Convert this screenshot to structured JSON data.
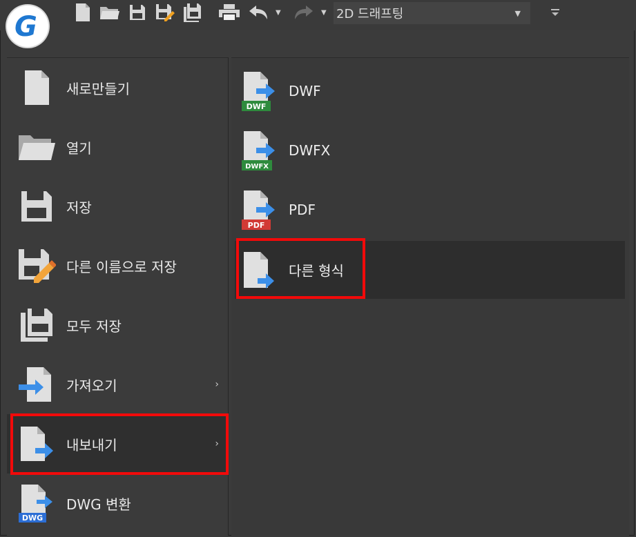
{
  "app": {
    "logo_letter": "G",
    "accent_color": "#1f78d1"
  },
  "quick_access": {
    "icons": [
      "new-file-icon",
      "open-folder-icon",
      "save-icon",
      "save-as-icon",
      "save-all-icon",
      "print-icon",
      "undo-icon",
      "redo-icon"
    ],
    "workspace_selected": "2D 드래프팅"
  },
  "left_menu": {
    "items": [
      {
        "label": "새로만들기",
        "icon": "new-document-icon"
      },
      {
        "label": "열기",
        "icon": "open-folder-icon"
      },
      {
        "label": "저장",
        "icon": "save-icon"
      },
      {
        "label": "다른 이름으로 저장",
        "icon": "save-as-icon"
      },
      {
        "label": "모두 저장",
        "icon": "save-all-icon"
      },
      {
        "label": "가져오기",
        "icon": "import-icon",
        "has_submenu": true
      },
      {
        "label": "내보내기",
        "icon": "export-icon",
        "has_submenu": true,
        "selected": true
      },
      {
        "label": "DWG 변환",
        "icon": "dwg-convert-icon"
      }
    ],
    "submenu_arrow": "›"
  },
  "export_submenu": {
    "items": [
      {
        "label": "DWF",
        "badge": "DWF",
        "badge_color": "#2e8b3d"
      },
      {
        "label": "DWFX",
        "badge": "DWFX",
        "badge_color": "#2e8b3d"
      },
      {
        "label": "PDF",
        "badge": "PDF",
        "badge_color": "#d23a35"
      },
      {
        "label": "다른 형식",
        "selected": true
      }
    ]
  },
  "dwg_badge": "DWG",
  "highlight_color": "#f20a0a"
}
